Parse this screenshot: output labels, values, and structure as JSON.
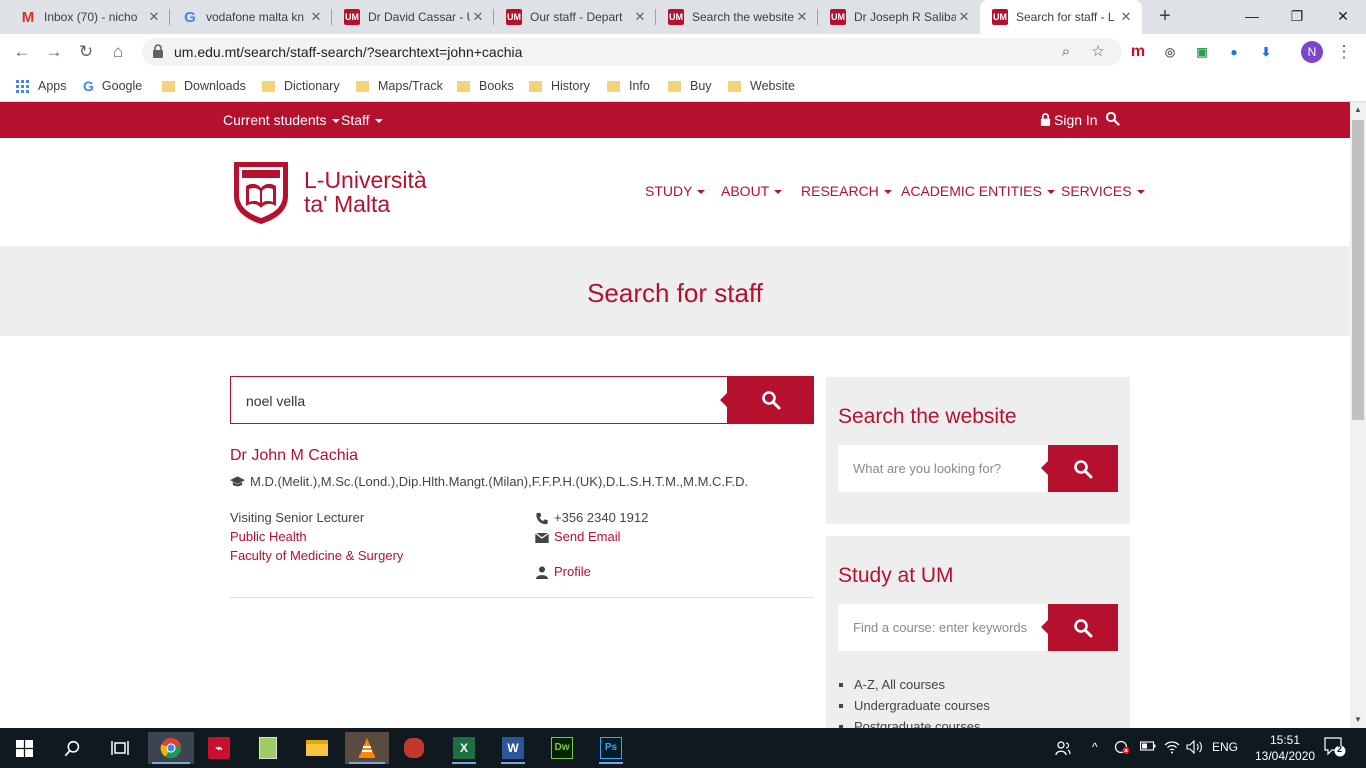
{
  "browser": {
    "tabs": [
      {
        "title": "Inbox (70) - nicho",
        "favicon": "gmail-icon",
        "active": false
      },
      {
        "title": "vodafone malta kn",
        "favicon": "google-icon",
        "active": false
      },
      {
        "title": "Dr David Cassar - U",
        "favicon": "um-icon",
        "active": false
      },
      {
        "title": "Our staff - Depart",
        "favicon": "um-icon",
        "active": false
      },
      {
        "title": "Search the website",
        "favicon": "um-icon",
        "active": false
      },
      {
        "title": "Dr Joseph R Saliba",
        "favicon": "um-icon",
        "active": false
      },
      {
        "title": "Search for staff - L",
        "favicon": "um-icon",
        "active": true
      }
    ],
    "url": "um.edu.mt/search/staff-search/?searchtext=john+cachia",
    "avatar_letter": "N",
    "um_favicon_text": "UM",
    "bookmarks": [
      "Apps",
      "Google",
      "Downloads",
      "Dictionary",
      "Maps/Track",
      "Books",
      "History",
      "Info",
      "Buy",
      "Website"
    ]
  },
  "site": {
    "topbar": {
      "current_students": "Current students",
      "staff": "Staff",
      "sign_in": "Sign In"
    },
    "logo": {
      "line1": "L-Università",
      "line2": "ta' Malta"
    },
    "nav": [
      "STUDY",
      "ABOUT",
      "RESEARCH",
      "ACADEMIC ENTITIES",
      "SERVICES"
    ],
    "banner_title": "Search for staff",
    "staff_search": {
      "value": "noel vella"
    },
    "result": {
      "name": "Dr John M Cachia",
      "qualifications": "M.D.(Melit.),M.Sc.(Lond.),Dip.Hlth.Mangt.(Milan),F.F.P.H.(UK),D.L.S.H.T.M.,M.M.C.F.D.",
      "position": "Visiting Senior Lecturer",
      "department": "Public Health",
      "faculty": "Faculty of Medicine & Surgery",
      "phone": "+356 2340 1912",
      "email_label": "Send Email",
      "profile_label": "Profile"
    },
    "sidebar": {
      "search_title": "Search the website",
      "search_placeholder": "What are you looking for?",
      "study_title": "Study at UM",
      "course_placeholder": "Find a course: enter keywords",
      "courses": [
        "A-Z, All courses",
        "Undergraduate courses",
        "Postgraduate courses"
      ]
    }
  },
  "taskbar": {
    "time": "15:51",
    "date": "13/04/2020",
    "lang": "ENG",
    "notifications": "2"
  },
  "colors": {
    "brand": "#b5112f",
    "banner_bg": "#eeeeee",
    "taskbar_bg": "#101820"
  }
}
